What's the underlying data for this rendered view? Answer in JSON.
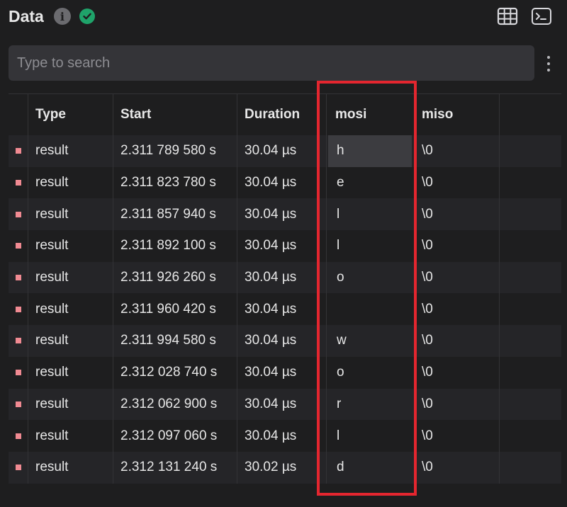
{
  "header": {
    "title": "Data",
    "info_icon": "info-icon",
    "status_icon": "check-circle-icon",
    "status_color": "#1fa36a"
  },
  "toolbar": {
    "table_view_icon": "table-grid-icon",
    "terminal_icon": "terminal-icon"
  },
  "search": {
    "placeholder": "Type to search",
    "value": ""
  },
  "table": {
    "columns": [
      "Type",
      "Start",
      "Duration",
      "mosi",
      "miso"
    ],
    "marker_color": "#f08a92",
    "rows": [
      {
        "type": "result",
        "start": "2.311 789 580 s",
        "duration": "30.04 µs",
        "mosi": "h",
        "miso": "\\0"
      },
      {
        "type": "result",
        "start": "2.311 823 780 s",
        "duration": "30.04 µs",
        "mosi": "e",
        "miso": "\\0"
      },
      {
        "type": "result",
        "start": "2.311 857 940 s",
        "duration": "30.04 µs",
        "mosi": "l",
        "miso": "\\0"
      },
      {
        "type": "result",
        "start": "2.311 892 100 s",
        "duration": "30.04 µs",
        "mosi": "l",
        "miso": "\\0"
      },
      {
        "type": "result",
        "start": "2.311 926 260 s",
        "duration": "30.04 µs",
        "mosi": "o",
        "miso": "\\0"
      },
      {
        "type": "result",
        "start": "2.311 960 420 s",
        "duration": "30.04 µs",
        "mosi": "",
        "miso": "\\0"
      },
      {
        "type": "result",
        "start": "2.311 994 580 s",
        "duration": "30.04 µs",
        "mosi": "w",
        "miso": "\\0"
      },
      {
        "type": "result",
        "start": "2.312 028 740 s",
        "duration": "30.04 µs",
        "mosi": "o",
        "miso": "\\0"
      },
      {
        "type": "result",
        "start": "2.312 062 900 s",
        "duration": "30.04 µs",
        "mosi": "r",
        "miso": "\\0"
      },
      {
        "type": "result",
        "start": "2.312 097 060 s",
        "duration": "30.04 µs",
        "mosi": "l",
        "miso": "\\0"
      },
      {
        "type": "result",
        "start": "2.312 131 240 s",
        "duration": "30.02 µs",
        "mosi": "d",
        "miso": "\\0"
      }
    ]
  },
  "annotation": {
    "highlight_color": "#e4262f"
  }
}
